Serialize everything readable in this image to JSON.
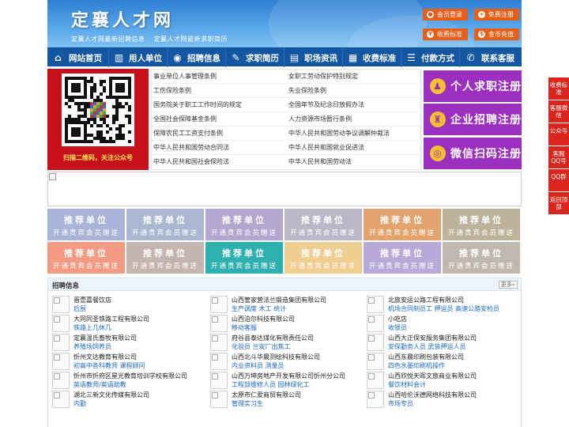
{
  "header": {
    "title": "定襄人才网",
    "subtitle_links": [
      "定襄人才网最新招聘信息",
      "定襄人才网最新求职简历"
    ],
    "buttons": [
      {
        "label": "会员登录",
        "icon": "user-icon"
      },
      {
        "label": "免费注册",
        "icon": "register-icon"
      },
      {
        "label": "收费标准",
        "icon": "price-icon"
      },
      {
        "label": "金币充值",
        "icon": "coin-icon"
      }
    ]
  },
  "nav": {
    "items": [
      {
        "label": "网站首页",
        "icon": "home-icon"
      },
      {
        "label": "用人单位",
        "icon": "building-icon"
      },
      {
        "label": "招聘信息",
        "icon": "broadcast-icon"
      },
      {
        "label": "求职简历",
        "icon": "resume-icon"
      },
      {
        "label": "职场资讯",
        "icon": "news-icon"
      },
      {
        "label": "收费标准",
        "icon": "fee-icon"
      },
      {
        "label": "付款方式",
        "icon": "payment-icon"
      },
      {
        "label": "联系客服",
        "icon": "phone-icon"
      }
    ]
  },
  "banner": {
    "qr_caption": "扫描二维码，关注公众号",
    "links": [
      [
        "事业单位人事管理条例",
        "女职工劳动保护特别规定"
      ],
      [
        "工伤保险条例",
        "失业保险条例"
      ],
      [
        "国务院关于职工工作时间的规定",
        "全国年节及纪念日放假办法"
      ],
      [
        "全国社会保障基金条例",
        "人力资源市场暂行条例"
      ],
      [
        "保障农民工工资支付条例",
        "中华人民共和国劳动争议调解仲裁法"
      ],
      [
        "中华人民共和国劳动合同法",
        "中华人民共和国就业促进法"
      ],
      [
        "中华人民共和国社会保险法",
        "中华人民共和国劳动法"
      ]
    ],
    "register_buttons": [
      {
        "label": "个人求职注册",
        "icon": "person-icon"
      },
      {
        "label": "企业招聘注册",
        "icon": "company-icon"
      },
      {
        "label": "微信扫码注册",
        "icon": "wechat-icon"
      }
    ]
  },
  "recommend": {
    "title": "推荐单位",
    "subtitle": "开通贵宾会员赠送",
    "colors": [
      "#a9b4d8",
      "#a9b8d0",
      "#b3a6cf",
      "#b8b8c9",
      "#e2a36c",
      "#bcb39a",
      "#f29a82",
      "#c4b4b0",
      "#2fb0b0",
      "#f0cd90",
      "#b9a9d8",
      "#c0b8ae"
    ]
  },
  "recruit": {
    "title": "招聘信息",
    "more": "更多»",
    "rows": [
      [
        {
          "company": "晋壹嘉餐饮店",
          "jobs": "后厨"
        },
        {
          "company": "山西管家营法兰锻造集团有限公司",
          "jobs": "生产调度 木工 统计"
        },
        {
          "company": "北旅安运公路工程有限公司",
          "jobs": "机场合同制员工 押运员 高速公路安检员"
        }
      ],
      [
        {
          "company": "大同同圣铁路工程有限公司",
          "jobs": "铁路上几休几"
        },
        {
          "company": "山西泊尔科技有限公司",
          "jobs": "移动客服"
        },
        {
          "company": "小吃店",
          "jobs": "收银员"
        }
      ],
      [
        {
          "company": "定襄温氏畜牧有限公司",
          "jobs": "养殖场饲养员"
        },
        {
          "company": "府谷县泰达煤化有限责任公司",
          "jobs": "化验员 兰炭厂出焦工"
        },
        {
          "company": "山西大正保安服务集团有限公司",
          "jobs": "安保勤务人员 武装押运人员"
        }
      ],
      [
        {
          "company": "忻州文达教育有限公司",
          "jobs": "初高中各科教师 课程顾问"
        },
        {
          "company": "山西北斗华晨测绘科技有限公司",
          "jobs": "内业资料员 测量员"
        },
        {
          "company": "山西东晨印刷包装有限公司",
          "jobs": "四色水墨印刷机操作"
        }
      ],
      [
        {
          "company": "忻州市忻府区星光教育培训学校有限公司",
          "jobs": "英语教师/英语助教"
        },
        {
          "company": "山西万坤房地产开发有限公司忻州分公司",
          "jobs": "工程部维修人员 园林绿化工"
        },
        {
          "company": "山西欣悦天晖文旅商业有限公司",
          "jobs": "餐饮材料会计"
        }
      ],
      [
        {
          "company": "湖北三新文化传媒有限公司",
          "jobs": "内勤"
        },
        {
          "company": "太原市仁爱商贸有限公司",
          "jobs": "管理实习生"
        },
        {
          "company": "山西哈伦沃德网络科技有限公司",
          "jobs": "市场专员"
        }
      ]
    ]
  },
  "side_float": [
    "收费标准",
    "客服微信",
    "公众号",
    "客服QQ号",
    "QQ群",
    "返回顶部"
  ],
  "colors": {
    "nav_bg": "#1357a3",
    "header_btn": "#e85d17",
    "register_btn": "#9c2ec0",
    "qr_bg": "#c8101a",
    "side_float": "#d9251c",
    "job_link": "#1a66c0"
  }
}
